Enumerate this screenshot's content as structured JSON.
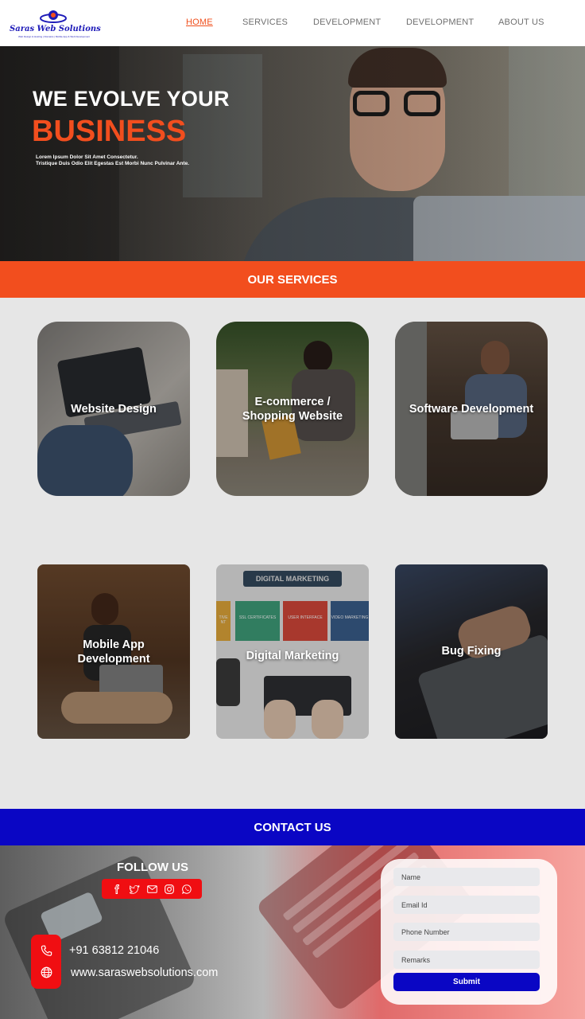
{
  "brand": {
    "name": "Saras Web Solutions",
    "tagline": "Web Design & Hosting | Domains | Mobile App & Web Development",
    "colors": {
      "orange": "#f24e1e",
      "blue": "#0a06c4",
      "red": "#f00e12"
    }
  },
  "nav": {
    "items": [
      {
        "label": "HOME",
        "active": true
      },
      {
        "label": "SERVICES",
        "active": false
      },
      {
        "label": "DEVELOPMENT",
        "active": false
      },
      {
        "label": "DEVELOPMENT",
        "active": false
      },
      {
        "label": "ABOUT US",
        "active": false
      }
    ]
  },
  "hero": {
    "title": "WE EVOLVE YOUR",
    "highlight": "BUSINESS",
    "subtitle_line1": "Lorem Ipsum Dolor Sit Amet Consectetur.",
    "subtitle_line2": "Tristique Duis Odio Elit Egestas Est Morbi Nunc Pulvinar Ante."
  },
  "services": {
    "heading": "OUR SERVICES",
    "cards": [
      {
        "line1": "Website Design",
        "line2": ""
      },
      {
        "line1": "E-commerce /",
        "line2": "Shopping Website"
      },
      {
        "line1": "Software Development",
        "line2": ""
      },
      {
        "line1": "Mobile App",
        "line2": "Development"
      },
      {
        "line1": "Digital Marketing",
        "line2": ""
      },
      {
        "line1": "Bug Fixing",
        "line2": ""
      }
    ],
    "digital_marketing_image_text": {
      "banner": "DIGITAL MARKETING",
      "tiles": [
        "TIVE NT",
        "SSL CERTIFICATES",
        "USER INTERFACE",
        "VIDEO MARKETING"
      ]
    }
  },
  "contact": {
    "heading": "CONTACT US",
    "follow_label": "FOLLOW US",
    "social_icons": [
      "facebook-icon",
      "twitter-icon",
      "mail-icon",
      "instagram-icon",
      "whatsapp-icon"
    ],
    "phone": "+91 63812 21046",
    "website": "www.saraswebsolutions.com",
    "form": {
      "name_placeholder": "Name",
      "email_placeholder": "Email Id",
      "phone_placeholder": "Phone Number",
      "remarks_placeholder": "Remarks",
      "submit_label": "Submit"
    }
  }
}
